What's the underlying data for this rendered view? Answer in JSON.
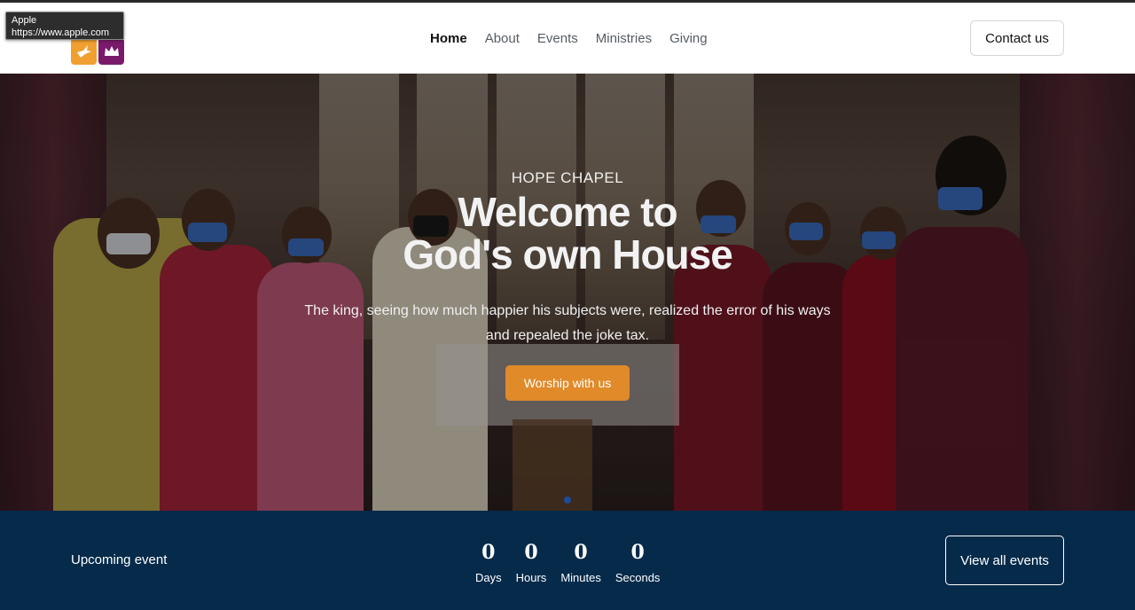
{
  "tooltip": {
    "title": "Apple",
    "url": "https://www.apple.com"
  },
  "brand": {
    "logo_icons": [
      "dove-icon",
      "crown-icon"
    ],
    "colors": {
      "dove_tile": "#f0a030",
      "crown_tile": "#7a1a6a"
    }
  },
  "nav": {
    "items": [
      {
        "label": "Home",
        "active": true
      },
      {
        "label": "About",
        "active": false
      },
      {
        "label": "Events",
        "active": false
      },
      {
        "label": "Ministries",
        "active": false
      },
      {
        "label": "Giving",
        "active": false
      }
    ],
    "contact_label": "Contact us"
  },
  "hero": {
    "kicker": "HOPE CHAPEL",
    "title_line1": "Welcome to",
    "title_line2": "God's own House",
    "lead": "The king, seeing how much happier his subjects were, realized the error of his ways and repealed the joke tax.",
    "cta_label": "Worship with us",
    "cta_color": "#e08a2a",
    "slide_count": 1,
    "active_slide": 1
  },
  "event_bar": {
    "label": "Upcoming event",
    "countdown": [
      {
        "value": "0",
        "caption": "Days"
      },
      {
        "value": "0",
        "caption": "Hours"
      },
      {
        "value": "0",
        "caption": "Minutes"
      },
      {
        "value": "0",
        "caption": "Seconds"
      }
    ],
    "view_all_label": "View all events",
    "background": "#052a4a"
  }
}
